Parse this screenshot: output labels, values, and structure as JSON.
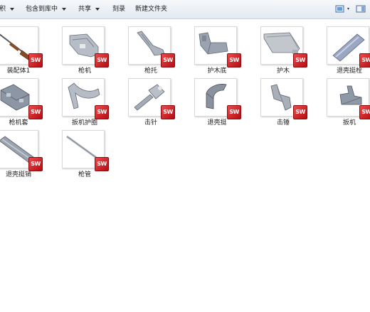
{
  "toolbar": {
    "items": [
      "积",
      "包含到库中",
      "共享",
      "刻录",
      "新建文件夹"
    ],
    "view_icon": "view-options-icon",
    "layout_icon": "preview-pane-icon"
  },
  "files": [
    {
      "name": "装配体1",
      "part": "rifle",
      "badge": "SW"
    },
    {
      "name": "枪机",
      "part": "bolt-housing",
      "badge": "SW"
    },
    {
      "name": "枪托",
      "part": "stock",
      "badge": "SW"
    },
    {
      "name": "护木底",
      "part": "handguard-base",
      "badge": "SW"
    },
    {
      "name": "护木",
      "part": "handguard",
      "badge": "SW"
    },
    {
      "name": "退壳挺栓",
      "part": "ejector-pin",
      "badge": "SW"
    },
    {
      "name": "枪机套",
      "part": "bolt-sleeve",
      "badge": "SW"
    },
    {
      "name": "扳机护圈",
      "part": "trigger-guard",
      "badge": "SW"
    },
    {
      "name": "击针",
      "part": "firing-pin",
      "badge": "SW"
    },
    {
      "name": "退壳挺",
      "part": "ejector",
      "badge": "SW"
    },
    {
      "name": "击锤",
      "part": "hammer",
      "badge": "SW"
    },
    {
      "name": "扳机",
      "part": "trigger",
      "badge": "SW"
    },
    {
      "name": "退壳挺销",
      "part": "ejector-pin-small",
      "badge": "SW"
    },
    {
      "name": "枪管",
      "part": "barrel",
      "badge": "SW"
    }
  ]
}
